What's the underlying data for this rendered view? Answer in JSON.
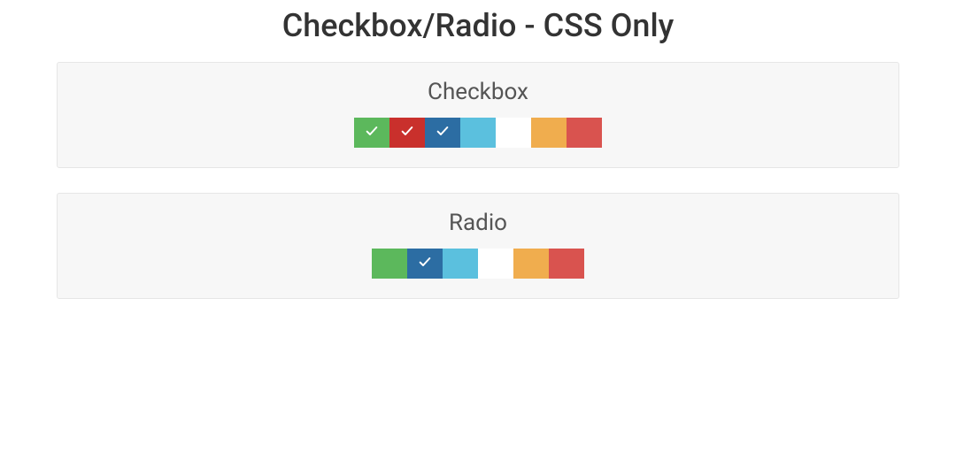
{
  "title": "Checkbox/Radio - CSS Only",
  "sections": {
    "checkbox": {
      "heading": "Checkbox",
      "items": [
        {
          "name": "success",
          "color": "#5cb85c",
          "checked": true
        },
        {
          "name": "danger",
          "color": "#c9302c",
          "checked": true
        },
        {
          "name": "primary",
          "color": "#2c6da3",
          "checked": true
        },
        {
          "name": "info",
          "color": "#5bc0de",
          "checked": false
        },
        {
          "name": "default",
          "color": "#ffffff",
          "checked": false
        },
        {
          "name": "warning",
          "color": "#f0ad4e",
          "checked": false
        },
        {
          "name": "red",
          "color": "#d9534f",
          "checked": false
        }
      ]
    },
    "radio": {
      "heading": "Radio",
      "items": [
        {
          "name": "success",
          "color": "#5cb85c",
          "checked": false
        },
        {
          "name": "primary",
          "color": "#2c6da3",
          "checked": true
        },
        {
          "name": "info",
          "color": "#5bc0de",
          "checked": false
        },
        {
          "name": "default",
          "color": "#ffffff",
          "checked": false
        },
        {
          "name": "warning",
          "color": "#f0ad4e",
          "checked": false
        },
        {
          "name": "red",
          "color": "#d9534f",
          "checked": false
        }
      ]
    }
  }
}
